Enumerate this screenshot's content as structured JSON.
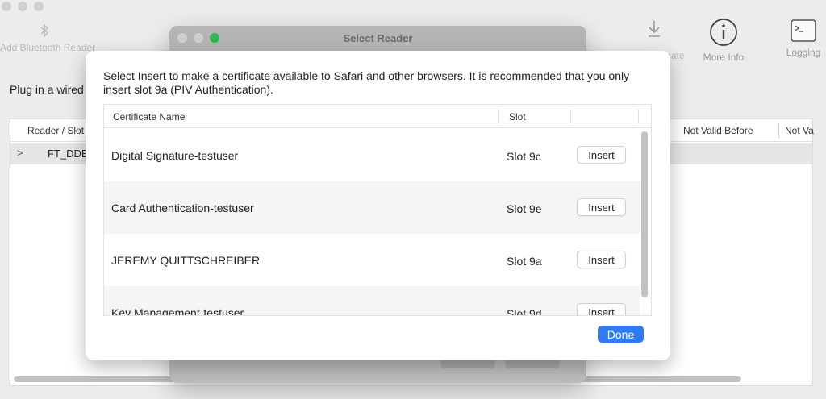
{
  "main": {
    "toolbar": {
      "add_bluetooth": "Add Bluetooth Reader",
      "certificate_partial": "cate",
      "more_info": "More Info",
      "logging": "Logging"
    },
    "plug_label": "Plug in a wired",
    "table": {
      "col_reader_slot": "Reader / Slot",
      "col_not_valid_before": "Not Valid Before",
      "col_not_valid_after": "Not Va",
      "row_name": "FT_DDE"
    }
  },
  "reader_window": {
    "title": "Select Reader"
  },
  "sheet": {
    "message": "Select Insert to make a certificate available to Safari and other browsers. It is recommended that you only insert slot 9a (PIV Authentication).",
    "columns": {
      "name": "Certificate Name",
      "slot": "Slot"
    },
    "rows": [
      {
        "name": "Digital Signature-testuser",
        "slot": "Slot 9c",
        "action": "Insert"
      },
      {
        "name": "Card Authentication-testuser",
        "slot": "Slot 9e",
        "action": "Insert"
      },
      {
        "name": "JEREMY QUITTSCHREIBER",
        "slot": "Slot 9a",
        "action": "Insert"
      },
      {
        "name": "Key Management-testuser",
        "slot": "Slot 9d",
        "action": "Insert"
      }
    ],
    "done_label": "Done"
  },
  "colors": {
    "accent": "#2f7bf5",
    "window_green": "#2fb94f"
  }
}
